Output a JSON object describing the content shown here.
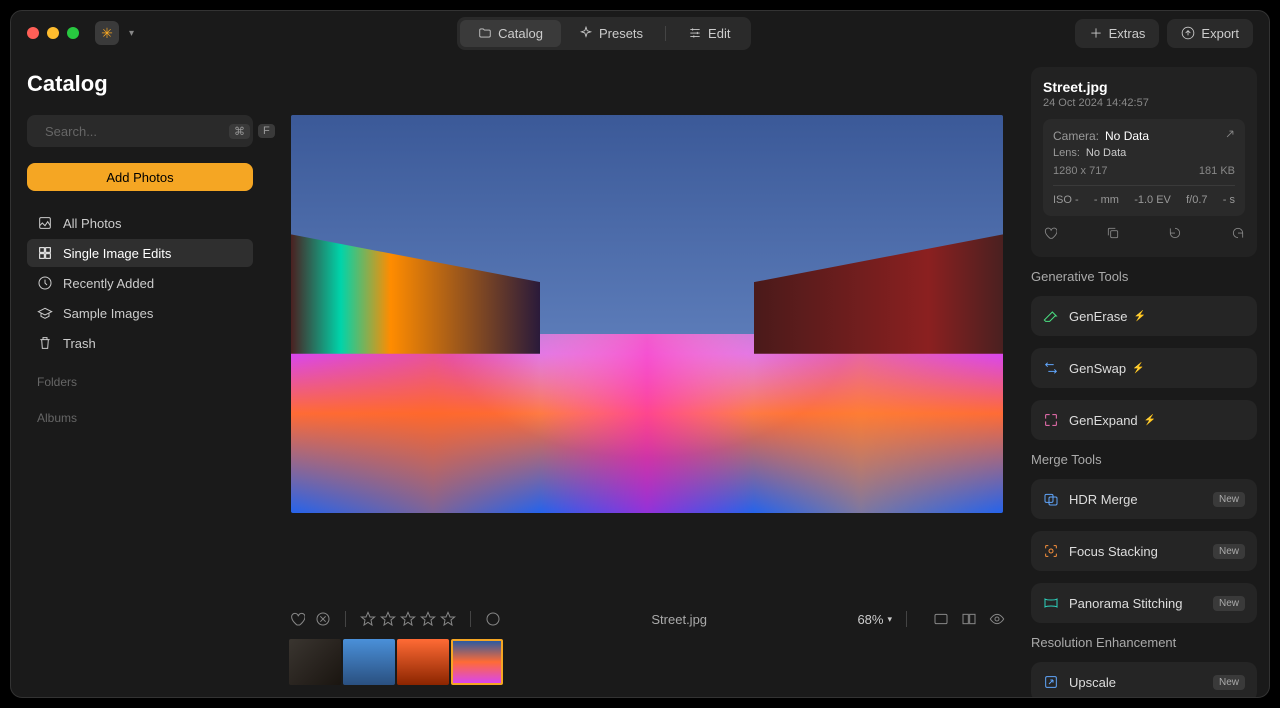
{
  "titlebar": {
    "tabs": {
      "catalog": "Catalog",
      "presets": "Presets",
      "edit": "Edit"
    },
    "extras": "Extras",
    "export": "Export"
  },
  "sidebar": {
    "title": "Catalog",
    "search_placeholder": "Search...",
    "kbd1": "⌘",
    "kbd2": "F",
    "add_photos": "Add Photos",
    "nav": {
      "all_photos": "All Photos",
      "single_edits": "Single Image Edits",
      "recently_added": "Recently Added",
      "sample_images": "Sample Images",
      "trash": "Trash"
    },
    "folders": "Folders",
    "albums": "Albums"
  },
  "viewer": {
    "filename": "Street.jpg",
    "zoom": "68%"
  },
  "metadata": {
    "filename": "Street.jpg",
    "date": "24 Oct 2024 14:42:57",
    "camera_label": "Camera:",
    "camera_value": "No Data",
    "lens_label": "Lens:",
    "lens_value": "No Data",
    "dimensions": "1280 x 717",
    "filesize": "181 KB",
    "iso": "ISO -",
    "mm": "- mm",
    "ev": "-1.0 EV",
    "fstop": "f/0.7",
    "shutter": "- s"
  },
  "tools": {
    "generative_label": "Generative Tools",
    "generase": "GenErase",
    "genswap": "GenSwap",
    "genexpand": "GenExpand",
    "merge_label": "Merge Tools",
    "hdr": "HDR Merge",
    "focus": "Focus Stacking",
    "panorama": "Panorama Stitching",
    "resolution_label": "Resolution Enhancement",
    "upscale": "Upscale",
    "new_badge": "New"
  }
}
